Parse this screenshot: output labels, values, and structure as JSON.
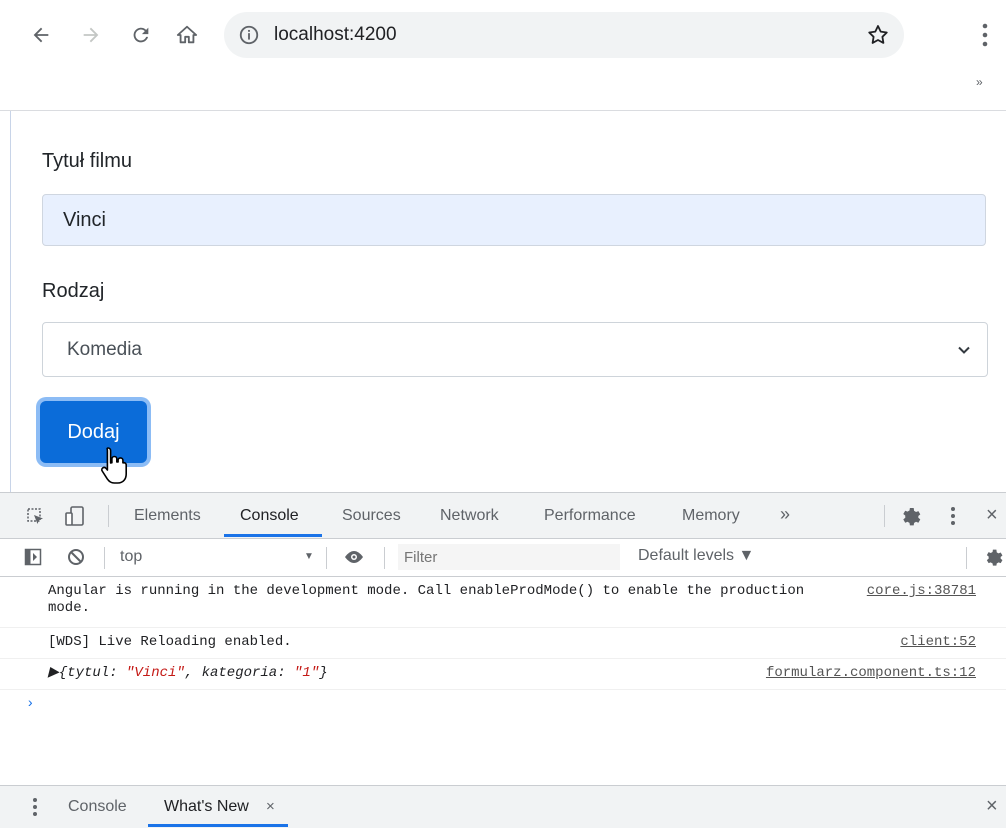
{
  "browser": {
    "url": "localhost:4200",
    "overflow_label": "»"
  },
  "form": {
    "title_label": "Tytuł filmu",
    "title_value": "Vinci",
    "category_label": "Rodzaj",
    "category_value": "Komedia",
    "submit_label": "Dodaj"
  },
  "devtools": {
    "tabs": [
      "Elements",
      "Console",
      "Sources",
      "Network",
      "Performance",
      "Memory"
    ],
    "more_tabs": "»",
    "active_tab": "Console",
    "context": "top",
    "filter_placeholder": "Filter",
    "levels": "Default levels ▼",
    "messages": [
      {
        "text": "Angular is running in the development mode. Call enableProdMode() to enable the production mode.",
        "source": "core.js:38781"
      },
      {
        "text": "[WDS] Live Reloading enabled.",
        "source": "client:52"
      },
      {
        "object_open": "▶{tytul: ",
        "tytul_value": "\"Vinci\"",
        "middle": ", kategoria: ",
        "kategoria_value": "\"1\"",
        "object_close": "}",
        "source": "formularz.component.ts:12"
      }
    ],
    "prompt": "›",
    "drawer_tabs": [
      "Console",
      "What's New"
    ],
    "drawer_close": "×",
    "close_label": "×"
  }
}
